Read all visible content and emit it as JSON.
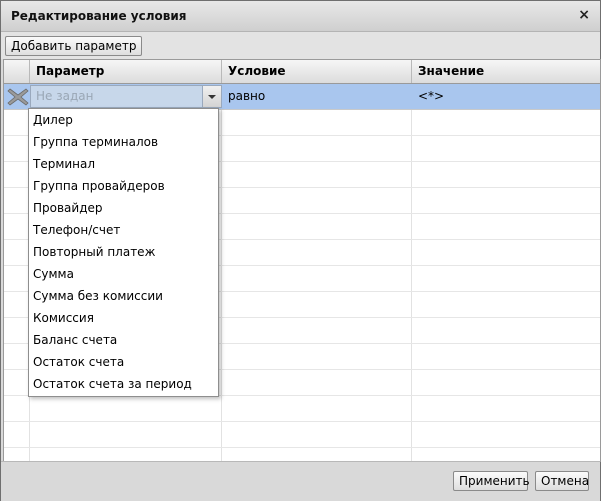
{
  "dialog": {
    "title": "Редактирование условия",
    "close_glyph": "×"
  },
  "toolbar": {
    "add_param_label": "Добавить параметр"
  },
  "grid": {
    "columns": [
      "Параметр",
      "Условие",
      "Значение"
    ],
    "row": {
      "param_placeholder": "Не задан",
      "condition": "равно",
      "value": "<*>"
    }
  },
  "dropdown": {
    "options": [
      "Дилер",
      "Группа терминалов",
      "Терминал",
      "Группа провайдеров",
      "Провайдер",
      "Телефон/счет",
      "Повторный платеж",
      "Сумма",
      "Сумма без комиссии",
      "Комиссия",
      "Баланс счета",
      "Остаток счета",
      "Остаток счета за период"
    ]
  },
  "footer": {
    "apply_label": "Применить",
    "cancel_label": "Отмена"
  },
  "icons": {
    "delete": "delete-icon",
    "close": "close-icon",
    "dropdown": "chevron-down-icon"
  },
  "colors": {
    "selected_row": "#a9c6ee"
  }
}
